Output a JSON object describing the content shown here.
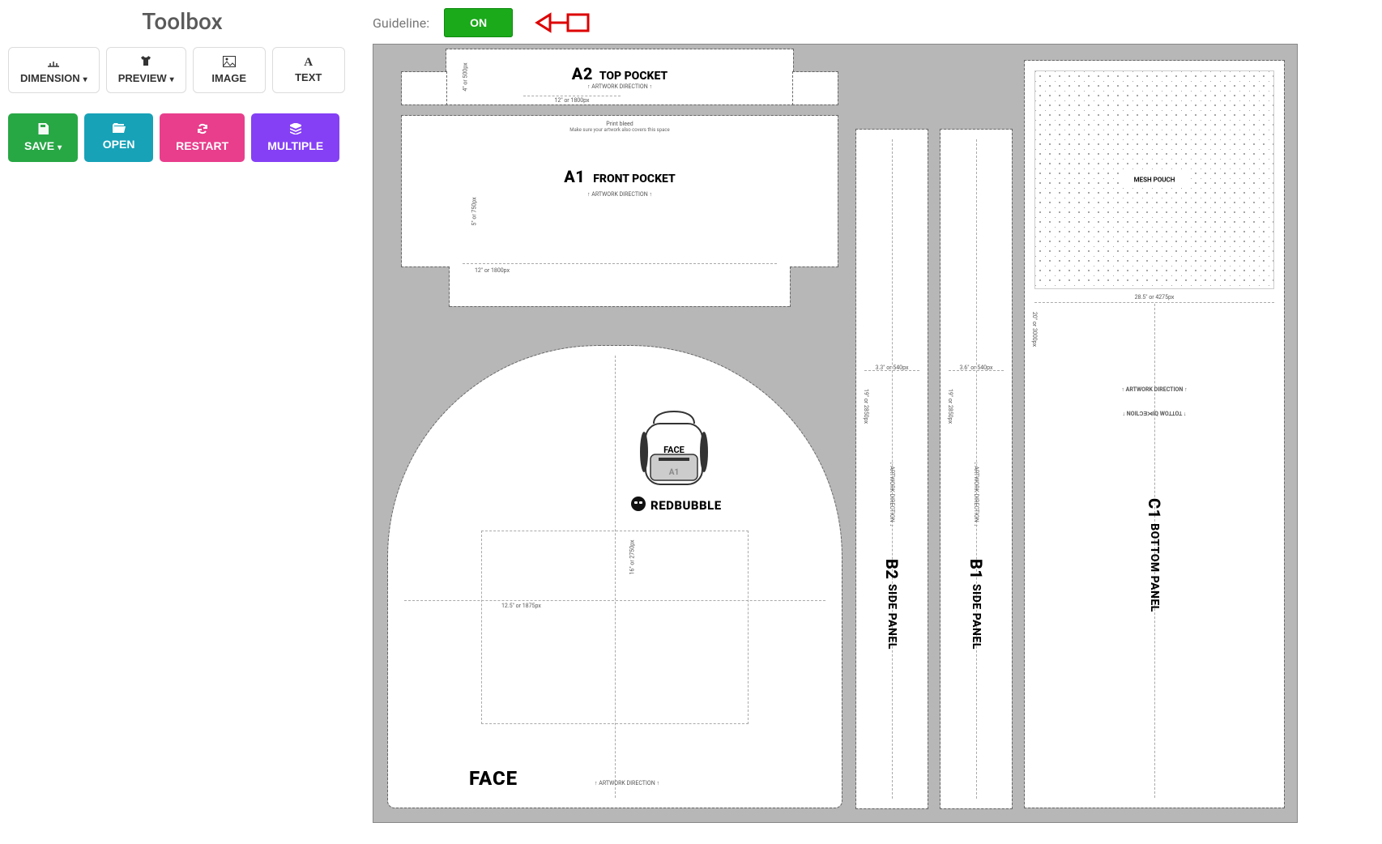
{
  "sidebar": {
    "title": "Toolbox",
    "tools": {
      "dimension": "DIMENSION",
      "preview": "PREVIEW",
      "image": "IMAGE",
      "text": "TEXT"
    },
    "actions": {
      "save": "SAVE",
      "open": "OPEN",
      "restart": "RESTART",
      "multiple": "MULTIPLE"
    }
  },
  "guideline": {
    "label": "Guideline:",
    "toggle": "ON"
  },
  "template": {
    "a2": {
      "title_a": "A2",
      "title_b": "TOP POCKET",
      "dir": "ARTWORK DIRECTION",
      "width": "12\" or 1800px",
      "height": "4\" or 500px"
    },
    "a1": {
      "title_a": "A1",
      "title_b": "FRONT POCKET",
      "bleed": "Print bleed",
      "bleed_note": "Make sure your artwork also covers this space",
      "dir": "ARTWORK DIRECTION",
      "width": "12\" or 1800px",
      "height": "5\" or 750px"
    },
    "face": {
      "label": "FACE",
      "dir": "ARTWORK DIRECTION",
      "width": "12.5\" or 1875px",
      "height": "16\" or 2750px",
      "brand": "REDBUBBLE",
      "bag_face": "FACE",
      "bag_a1": "A1"
    },
    "b2": {
      "title_a": "B2",
      "title_b": "SIDE PANEL",
      "dir": "ARTWORK DIRECTION",
      "width": "3.3\" or 540px",
      "height": "19\" or 2850px"
    },
    "b1": {
      "title_a": "B1",
      "title_b": "SIDE PANEL",
      "dir": "ARTWORK DIRECTION",
      "width": "3.6\" or 540px",
      "height": "19\" or 2850px"
    },
    "c1": {
      "title_a": "C1",
      "title_b": "BOTTOM PANEL",
      "dir_up": "ARTWORK DIRECTION",
      "dir_down": "NOILƆƎ⋊IQ WOꞱꞱOꞱ",
      "width": "28.5\" or 4275px",
      "height": "20\" or 3000px",
      "mesh": "MESH POUCH"
    }
  }
}
